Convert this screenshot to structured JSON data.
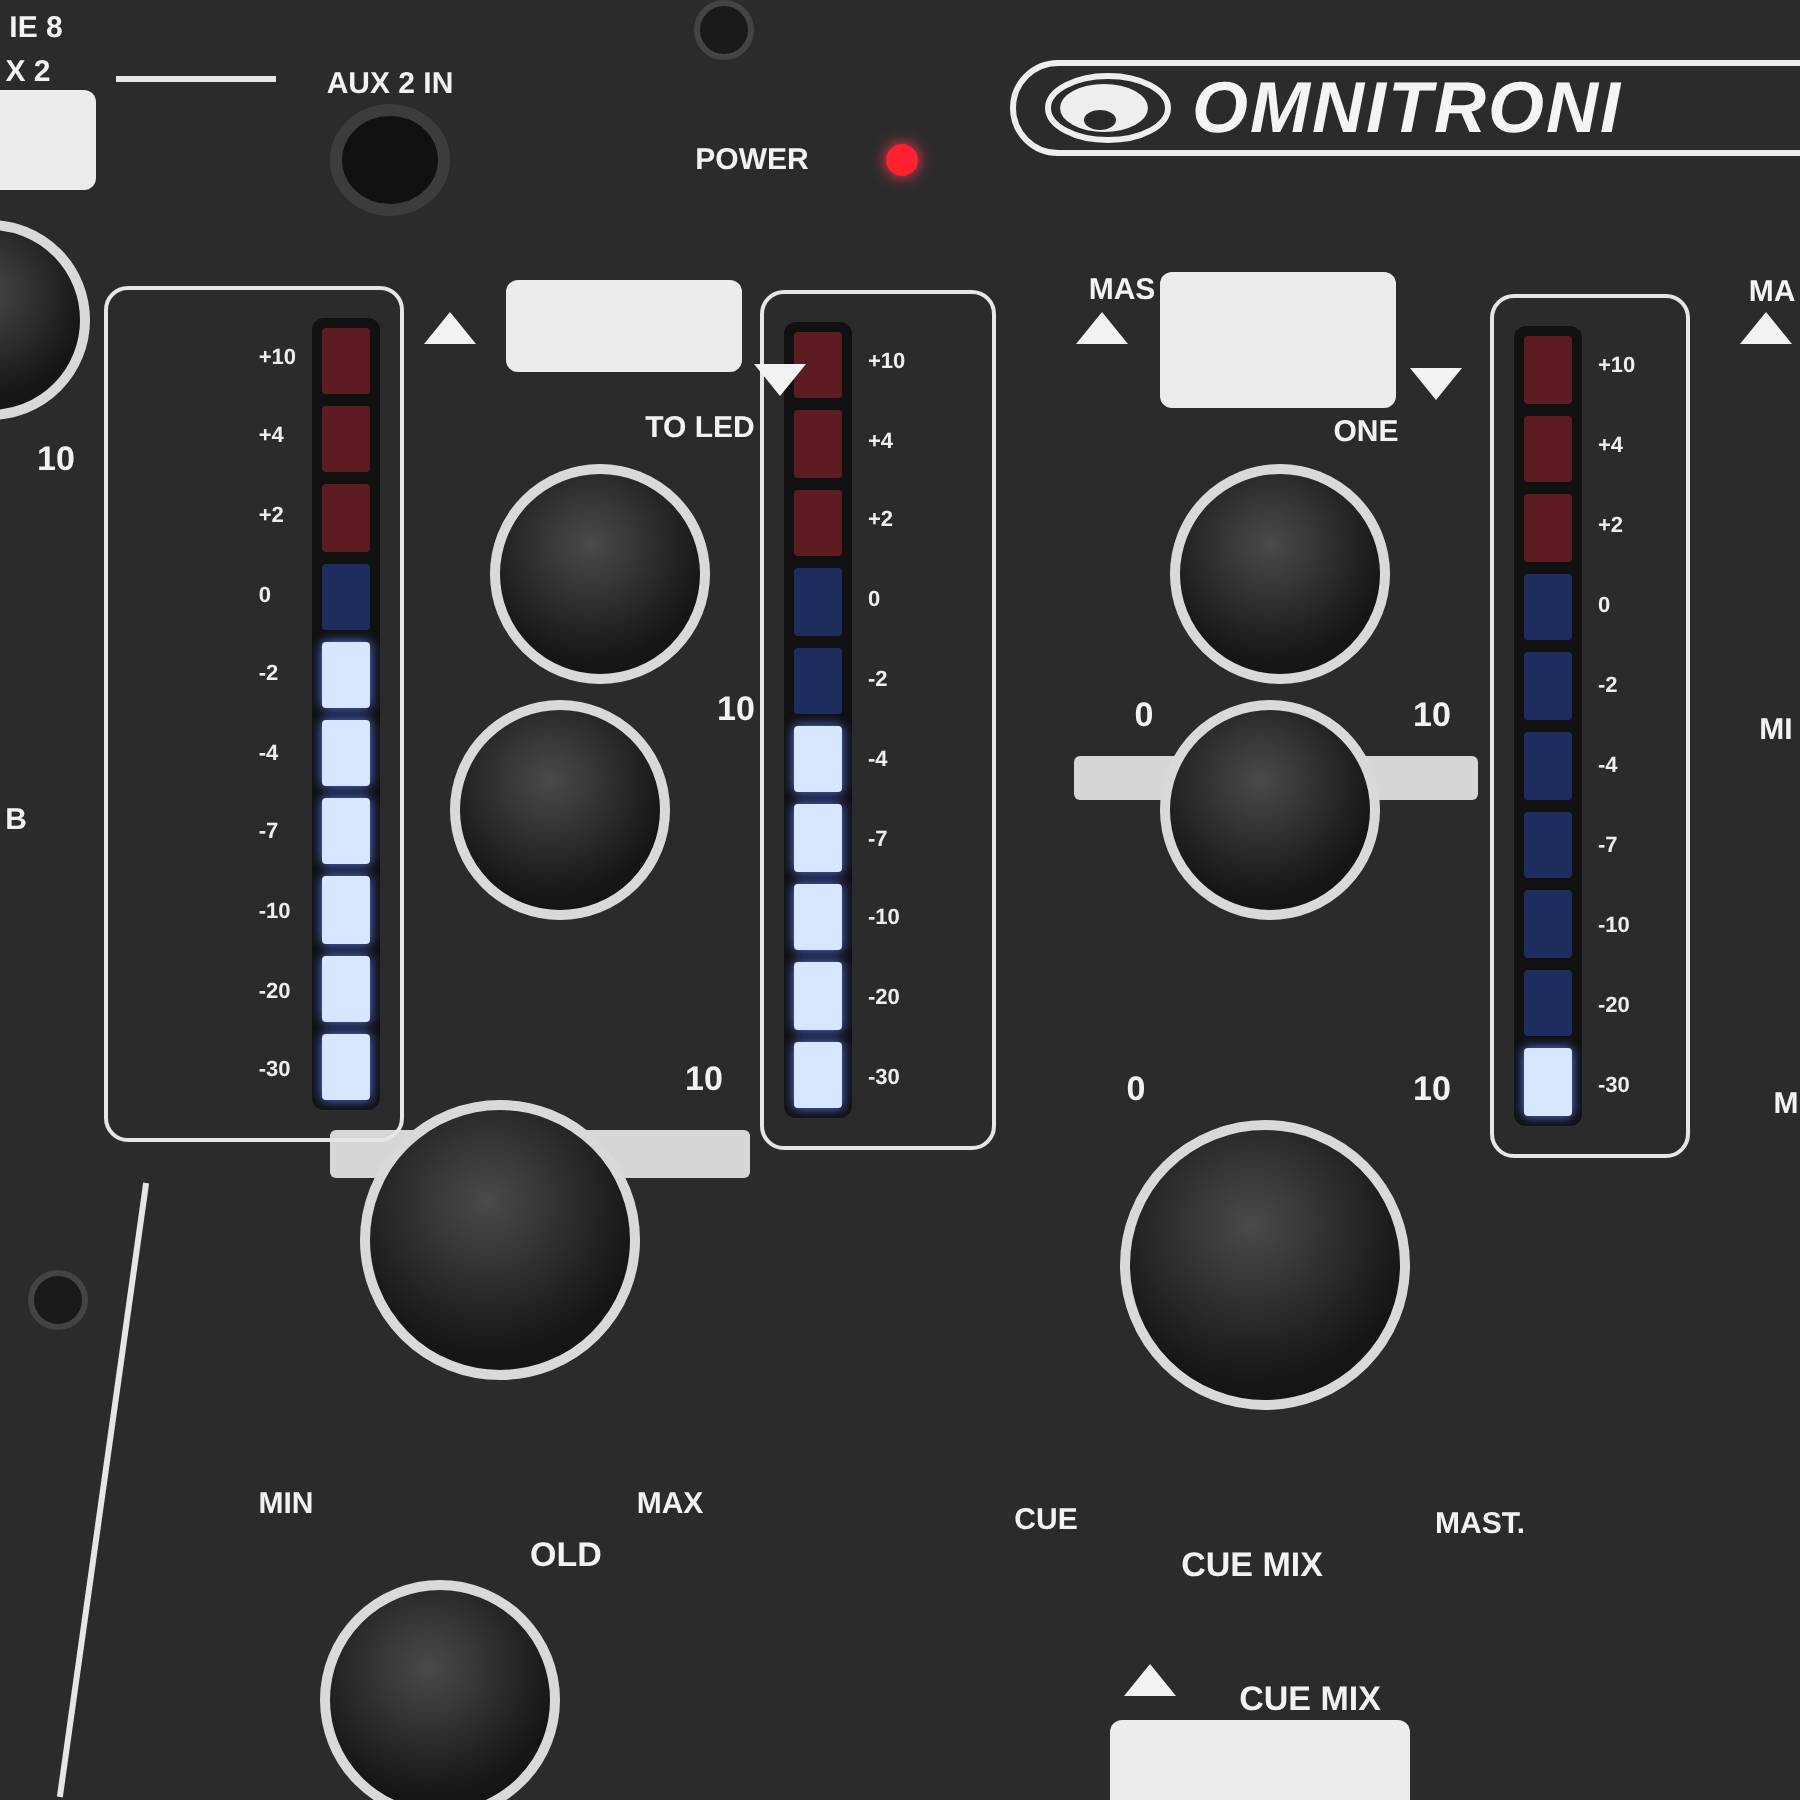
{
  "brand": "OMNITRONI",
  "top_labels": {
    "channel_label_top": "IE 8",
    "channel_label_bottom": "X 2",
    "aux_input": "AUX 2 IN",
    "power": "POWER"
  },
  "power_led": {
    "on": true
  },
  "meters": [
    {
      "scale": [
        "+10",
        "+4",
        "+2",
        "0",
        "-2",
        "-4",
        "-7",
        "-10",
        "-20",
        "-30"
      ],
      "level": 0.6
    },
    {
      "scale": [
        "+10",
        "+4",
        "+2",
        "0",
        "-2",
        "-4",
        "-7",
        "-10",
        "-20",
        "-30"
      ],
      "level": 0.5
    },
    {
      "scale": [
        "+10",
        "+4",
        "+2",
        "0",
        "-2",
        "-4",
        "-7",
        "-10",
        "-20",
        "-30"
      ],
      "level": 0.1
    }
  ],
  "knob_labels": [
    "10",
    "10",
    "10",
    "0",
    "10",
    "0",
    "10",
    "MIN",
    "MAX",
    "OLD",
    "CUE",
    "CUE MIX",
    "MAST.",
    "TO LED",
    "ONE",
    "MAS",
    "MA",
    "MI",
    "M",
    "B"
  ],
  "button_label": "CUE MIX"
}
